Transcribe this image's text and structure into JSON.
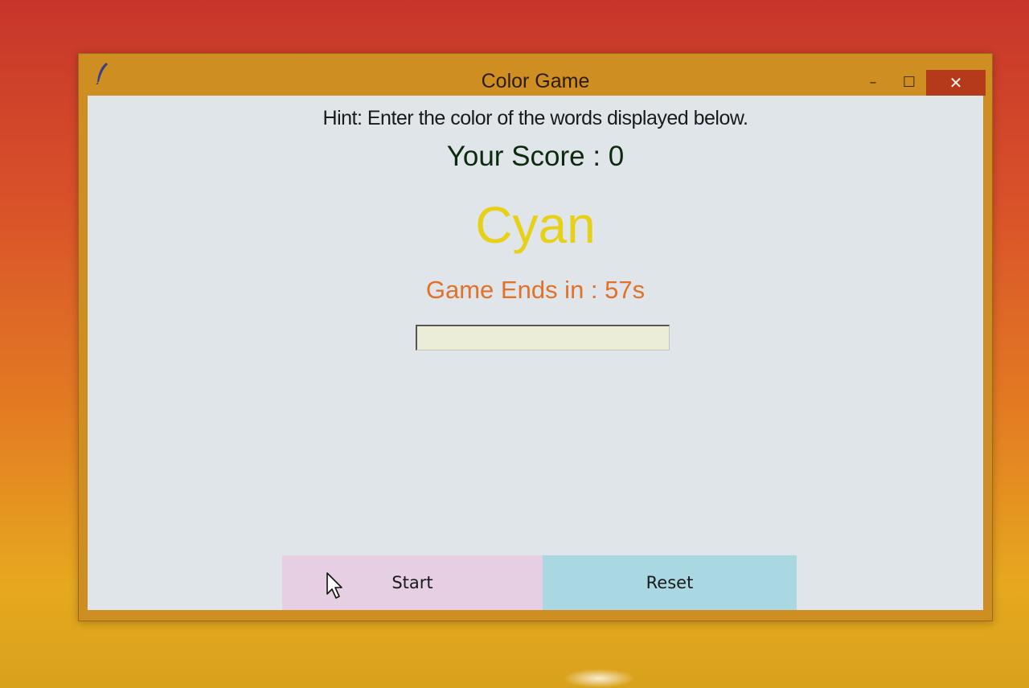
{
  "window": {
    "title": "Color Game",
    "minimize_glyph": "–",
    "maximize_glyph": "☐",
    "close_glyph": "✕"
  },
  "game": {
    "hint": "Hint: Enter the color of the words displayed below.",
    "score_text": "Your Score : 0",
    "word": "Cyan",
    "word_color": "#e6d117",
    "timer_text": "Game Ends in : 57s",
    "timer_color": "#e2712a",
    "answer_value": ""
  },
  "buttons": {
    "start_label": "Start",
    "reset_label": "Reset"
  },
  "icons": {
    "app_icon": "feather-icon",
    "cursor": "mouse-cursor-icon"
  },
  "colors": {
    "start_button": "#e6cfe3",
    "reset_button": "#a9d8e3",
    "title_bar": "#cf8e22",
    "close_button": "#b53a1c"
  }
}
